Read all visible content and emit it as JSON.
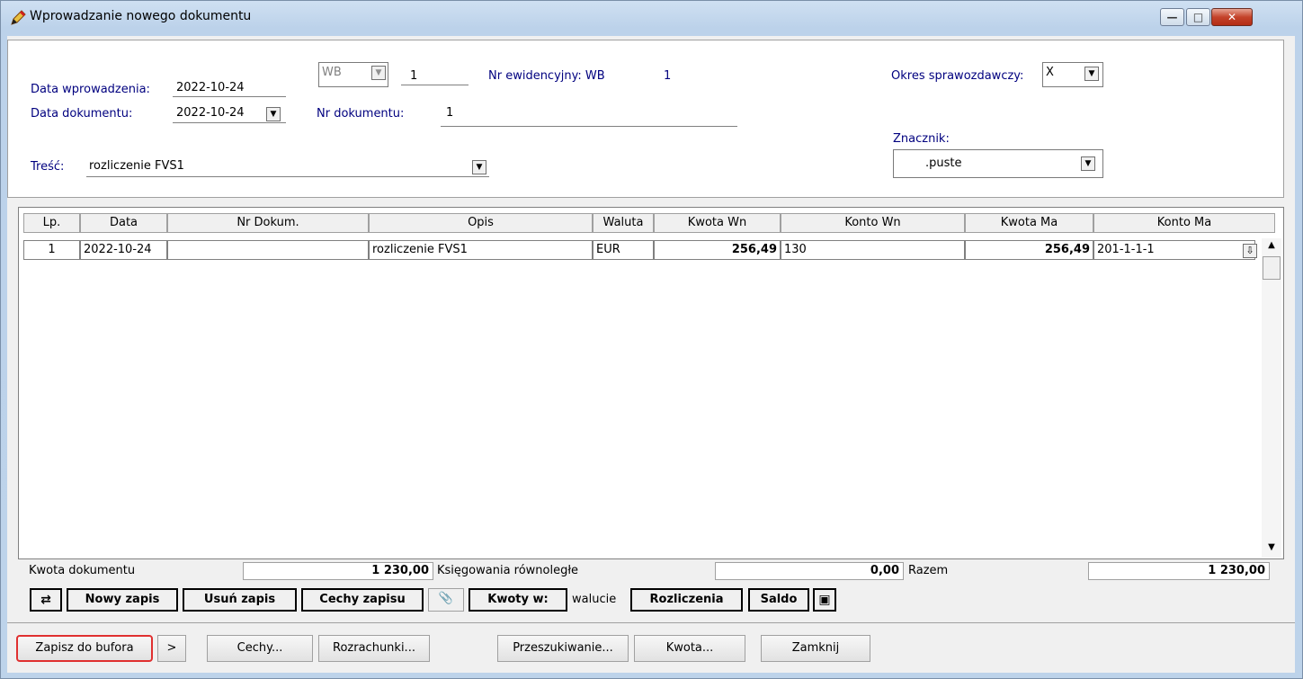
{
  "window": {
    "title": "Wprowadzanie nowego dokumentu"
  },
  "header": {
    "data_wprowadzenia_label": "Data wprowadzenia:",
    "data_wprowadzenia_value": "2022-10-24",
    "data_dokumentu_label": "Data dokumentu:",
    "data_dokumentu_value": "2022-10-24",
    "rejestr_value": "WB",
    "nr_value": "1",
    "nr_ewid_label": "Nr ewidencyjny: WB",
    "nr_ewid_value": "1",
    "nr_dokumentu_label": "Nr dokumentu:",
    "nr_dokumentu_value": "1",
    "tresc_label": "Treść:",
    "tresc_value": "rozliczenie FVS1",
    "okres_label": "Okres sprawozdawczy:",
    "okres_value": "X",
    "znacznik_label": "Znacznik:",
    "znacznik_value": ".puste"
  },
  "grid": {
    "columns": [
      "Lp.",
      "Data",
      "Nr Dokum.",
      "Opis",
      "Waluta",
      "Kwota Wn",
      "Konto Wn",
      "Kwota Ma",
      "Konto Ma"
    ],
    "rows": [
      {
        "lp": "1",
        "data": "2022-10-24",
        "nr_dokum": "",
        "opis": "rozliczenie FVS1",
        "waluta": "EUR",
        "kwota_wn": "256,49",
        "konto_wn": "130",
        "kwota_ma": "256,49",
        "konto_ma": "201-1-1-1"
      }
    ]
  },
  "summary": {
    "kwota_dokumentu_label": "Kwota dokumentu",
    "kwota_dokumentu_value": "1 230,00",
    "ksiegowania_label": "Księgowania równoległe",
    "ksiegowania_value": "0,00",
    "razem_label": "Razem",
    "razem_value": "1 230,00"
  },
  "toolbar": {
    "nowy_zapis": "Nowy zapis",
    "usun_zapis": "Usuń zapis",
    "cechy_zapisu": "Cechy zapisu",
    "kwoty_w": "Kwoty w:",
    "walucie": "walucie",
    "rozliczenia": "Rozliczenia",
    "saldo": "Saldo"
  },
  "buttons": {
    "zapisz": "Zapisz do bufora",
    "more": ">",
    "cechy": "Cechy...",
    "rozrachunki": "Rozrachunki...",
    "przeszukiwanie": "Przeszukiwanie...",
    "kwota": "Kwota...",
    "zamknij": "Zamknij"
  }
}
